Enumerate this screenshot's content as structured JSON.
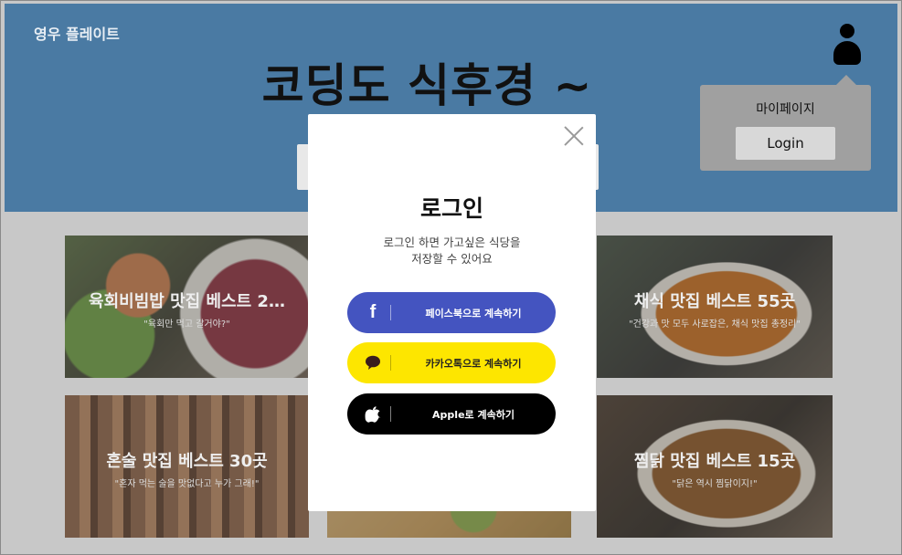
{
  "header": {
    "brand": "영우 플레이트",
    "title": "코딩도 식후경 ~"
  },
  "user_menu": {
    "mypage_label": "마이페이지",
    "login_label": "Login"
  },
  "cards": [
    {
      "title": "육회비빔밥 맛집 베스트 2…",
      "subtitle": "\"육회만 먹고 갈거야?\""
    },
    {
      "title": "채식 맛집 베스트 55곳",
      "subtitle": "\"건강과 맛 모두 사로잡은, 채식 맛집 총정리\""
    },
    {
      "title": "혼술 맛집 베스트 30곳",
      "subtitle": "\"혼자 먹는 술을 맛없다고 누가 그래!\""
    },
    {
      "title": "찜닭 맛집 베스트 15곳",
      "subtitle": "\"닭은 역시 찜닭이지!\""
    }
  ],
  "login_modal": {
    "title": "로그인",
    "desc_line1": "로그인 하면 가고싶은 식당을",
    "desc_line2": "저장할 수 있어요",
    "facebook_label": "페이스북으로 계속하기",
    "kakao_label": "카카오톡으로 계속하기",
    "apple_label": "Apple로 계속하기"
  },
  "icons": {
    "user": "user-icon",
    "close": "close-icon",
    "facebook": "facebook-icon",
    "kakao": "kakao-icon",
    "apple": "apple-icon"
  },
  "colors": {
    "header_bg": "#4a7aa3",
    "facebook": "#4454c0",
    "kakao": "#fde600",
    "apple": "#000000"
  }
}
